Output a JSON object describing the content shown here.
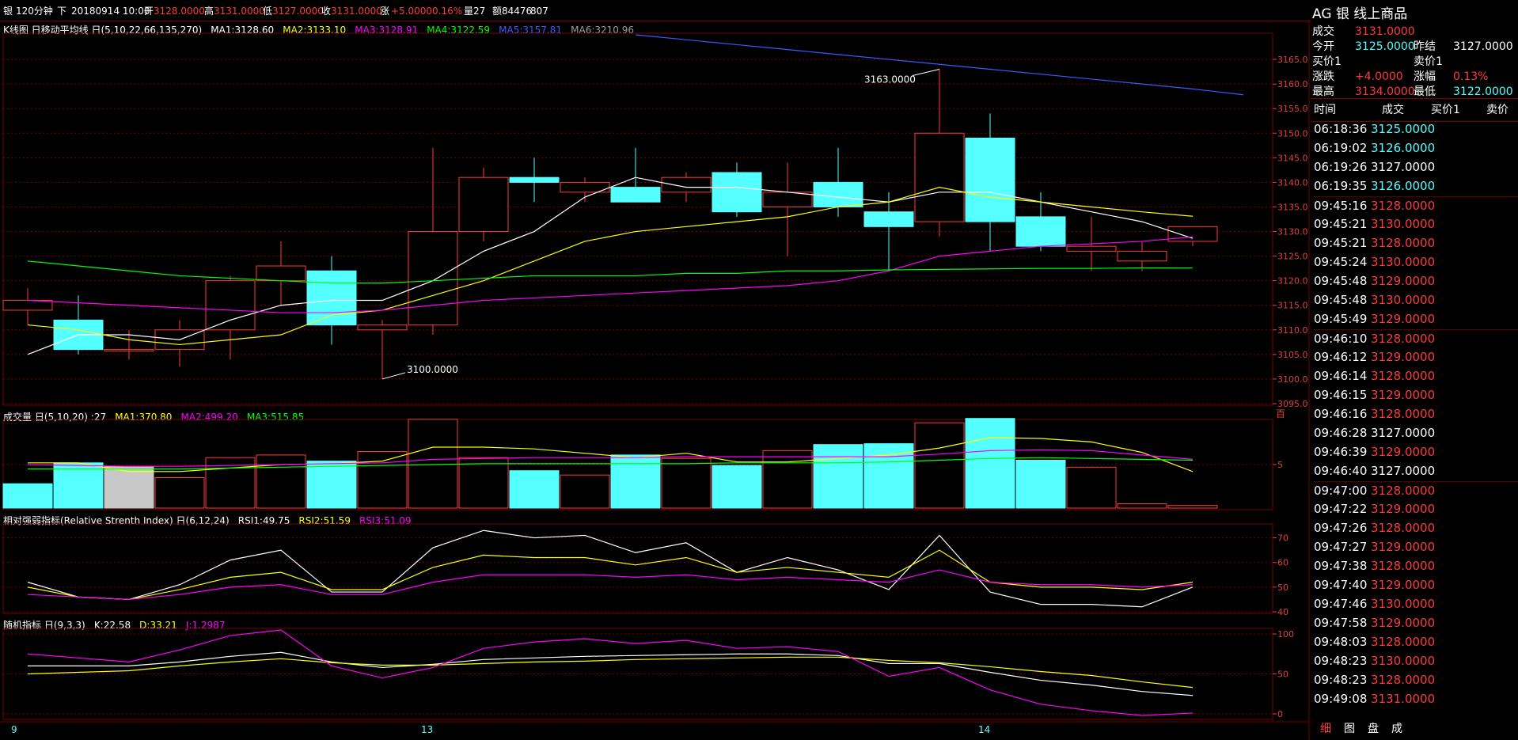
{
  "header": {
    "symbol": "银",
    "period": "120分钟",
    "direction": "下",
    "datetime": "20180914 10:00",
    "open_label": "开",
    "open": "3128.0000",
    "high_label": "高",
    "high": "3131.0000",
    "low_label": "低",
    "low": "3127.0000",
    "close_label": "收",
    "close": "3131.0000",
    "change_label": "涨",
    "change": "+5.0000",
    "change_pct": "0.16%",
    "volume_label": "量27",
    "amount_label": "额84476",
    "extra": "807"
  },
  "panels": {
    "kline": {
      "title": "K线图 日移动平均线 日(5,10,22,66,135,270)",
      "ma": [
        {
          "label": "MA1:3128.60",
          "color": "#ffffff"
        },
        {
          "label": "MA2:3133.10",
          "color": "#ffff00"
        },
        {
          "label": "MA3:3128.91",
          "color": "#ff00ff"
        },
        {
          "label": "MA4:3122.59",
          "color": "#00ff00"
        },
        {
          "label": "MA5:3157.81",
          "color": "#3a5bff"
        },
        {
          "label": "MA6:3210.96",
          "color": "#9b9b9b"
        }
      ],
      "max_annotation": "3163.0000",
      "min_annotation": "3100.0000"
    },
    "volume": {
      "title": "成交量 日(5,10,20) :27",
      "ma": [
        {
          "label": "MA1:370.80",
          "color": "#ffff00"
        },
        {
          "label": "MA2:499.20",
          "color": "#ff00ff"
        },
        {
          "label": "MA3:515.85",
          "color": "#00ff00"
        }
      ],
      "unit": "百"
    },
    "rsi": {
      "title": "相对强弱指标(Relative Strenth Index) 日(6,12,24)",
      "ma": [
        {
          "label": "RSI1:49.75",
          "color": "#ffffff"
        },
        {
          "label": "RSI2:51.59",
          "color": "#ffff00"
        },
        {
          "label": "RSI3:51.09",
          "color": "#ff00ff"
        }
      ]
    },
    "kdj": {
      "title": "随机指标 日(9,3,3)",
      "ma": [
        {
          "label": "K:22.58",
          "color": "#ffffff"
        },
        {
          "label": "D:33.21",
          "color": "#ffff00"
        },
        {
          "label": "J:1.2987",
          "color": "#ff00ff"
        }
      ]
    }
  },
  "x_axis_labels": [
    {
      "index": 0,
      "label": "9"
    },
    {
      "index": 8,
      "label": "13"
    },
    {
      "index": 19,
      "label": "14"
    }
  ],
  "colors": {
    "up": "#ff3a3a",
    "down": "#54ffff",
    "grid": "#7a0000",
    "axis_text": "#e04040"
  },
  "chart_data": [
    {
      "type": "candlestick",
      "panel": "kline",
      "ylim": [
        3095,
        3170
      ],
      "yticks": [
        "3095.0",
        "3100.0",
        "3105.0",
        "3110.0",
        "3115.0",
        "3120.0",
        "3125.0",
        "3130.0",
        "3135.0",
        "3140.0",
        "3145.0",
        "3150.0",
        "3155.0",
        "3160.0",
        "3165.0"
      ],
      "candles": [
        {
          "o": 3114,
          "h": 3118.5,
          "l": 3111,
          "c": 3116
        },
        {
          "o": 3112,
          "h": 3117,
          "l": 3105,
          "c": 3106
        },
        {
          "o": 3106,
          "h": 3110,
          "l": 3104,
          "c": 3106
        },
        {
          "o": 3106,
          "h": 3112,
          "l": 3102.5,
          "c": 3110
        },
        {
          "o": 3110,
          "h": 3121,
          "l": 3104,
          "c": 3120
        },
        {
          "o": 3120,
          "h": 3128,
          "l": 3115,
          "c": 3123
        },
        {
          "o": 3122,
          "h": 3125,
          "l": 3107,
          "c": 3111
        },
        {
          "o": 3110,
          "h": 3112,
          "l": 3100,
          "c": 3111
        },
        {
          "o": 3111,
          "h": 3147,
          "l": 3109,
          "c": 3130
        },
        {
          "o": 3130,
          "h": 3143,
          "l": 3128,
          "c": 3141
        },
        {
          "o": 3141,
          "h": 3145,
          "l": 3136,
          "c": 3140
        },
        {
          "o": 3138,
          "h": 3141,
          "l": 3136,
          "c": 3140
        },
        {
          "o": 3139,
          "h": 3147,
          "l": 3136,
          "c": 3136
        },
        {
          "o": 3138,
          "h": 3142,
          "l": 3136,
          "c": 3141
        },
        {
          "o": 3142,
          "h": 3144,
          "l": 3133,
          "c": 3134
        },
        {
          "o": 3135,
          "h": 3144,
          "l": 3125,
          "c": 3138
        },
        {
          "o": 3140,
          "h": 3147,
          "l": 3133,
          "c": 3135
        },
        {
          "o": 3134,
          "h": 3138,
          "l": 3122,
          "c": 3131
        },
        {
          "o": 3132,
          "h": 3163,
          "l": 3129,
          "c": 3150
        },
        {
          "o": 3149,
          "h": 3154,
          "l": 3126,
          "c": 3132
        },
        {
          "o": 3133,
          "h": 3138,
          "l": 3126,
          "c": 3127
        },
        {
          "o": 3126,
          "h": 3133,
          "l": 3122,
          "c": 3127
        },
        {
          "o": 3124,
          "h": 3128,
          "l": 3122,
          "c": 3126
        },
        {
          "o": 3128,
          "h": 3131,
          "l": 3127,
          "c": 3131
        }
      ],
      "ma_lines": [
        {
          "name": "MA1",
          "color": "#ffffff",
          "values": [
            3105,
            3109,
            3109,
            3108,
            3112,
            3115,
            3116,
            3116,
            3120,
            3126,
            3130,
            3137,
            3141,
            3139,
            3139,
            3138,
            3137,
            3136,
            3138,
            3138,
            3136,
            3134,
            3132,
            3128.6
          ]
        },
        {
          "name": "MA2",
          "color": "#ffff00",
          "values": [
            3111,
            3110,
            3108,
            3107,
            3108,
            3109,
            3113,
            3114,
            3117,
            3120,
            3124,
            3128,
            3130,
            3131,
            3132,
            3133,
            3135,
            3136,
            3139,
            3137,
            3136,
            3135,
            3134,
            3133.1
          ]
        },
        {
          "name": "MA3",
          "color": "#ff00ff",
          "values": [
            3116,
            3115.5,
            3115,
            3114.5,
            3114,
            3113.5,
            3113.5,
            3114,
            3115,
            3116,
            3116.5,
            3117,
            3117.5,
            3118,
            3118.5,
            3119,
            3120,
            3122,
            3125,
            3126,
            3127,
            3127.5,
            3128,
            3128.91
          ]
        },
        {
          "name": "MA4",
          "color": "#00ff00",
          "values": [
            3124,
            3123,
            3122,
            3121,
            3120.5,
            3120,
            3119.5,
            3119.5,
            3120,
            3120.5,
            3121,
            3121,
            3121,
            3121.5,
            3121.5,
            3122,
            3122,
            3122.2,
            3122.3,
            3122.4,
            3122.5,
            3122.5,
            3122.6,
            3122.59
          ]
        },
        {
          "name": "MA5",
          "color": "#3a5bff",
          "start": 12,
          "values": [
            3170,
            3169,
            3168,
            3167,
            3166,
            3165,
            3164,
            3163,
            3162,
            3161,
            3160,
            3159,
            3157.81
          ]
        }
      ]
    },
    {
      "type": "bar",
      "panel": "volume",
      "ylim": [
        0,
        10
      ],
      "ytick_label": "5",
      "values": [
        2.8,
        5.2,
        4.8,
        3.5,
        5.8,
        6.1,
        5.4,
        6.5,
        10.2,
        5.8,
        4.3,
        3.8,
        6.1,
        5.7,
        4.9,
        6.6,
        7.3,
        7.4,
        9.8,
        10.3,
        5.5,
        4.7,
        0.5,
        0.3
      ],
      "direction": [
        "down",
        "down",
        "flat",
        "up",
        "up",
        "up",
        "down",
        "up",
        "up",
        "up",
        "down",
        "up",
        "down",
        "up",
        "down",
        "up",
        "down",
        "down",
        "up",
        "down",
        "down",
        "up",
        "up",
        "up"
      ],
      "ma_lines": [
        {
          "name": "MA1",
          "color": "#ffff00",
          "values": [
            5.2,
            5.2,
            4.2,
            4.2,
            4.6,
            5.0,
            5.1,
            5.4,
            7.0,
            7.0,
            6.8,
            6.3,
            5.8,
            6.3,
            5.3,
            5.3,
            5.7,
            6.1,
            6.9,
            8.1,
            8.0,
            7.6,
            6.4,
            4.2
          ]
        },
        {
          "name": "MA2",
          "color": "#ff00ff",
          "values": [
            5.0,
            4.9,
            4.8,
            4.8,
            4.9,
            5.0,
            5.1,
            5.2,
            5.6,
            5.7,
            5.8,
            5.8,
            5.8,
            5.9,
            5.9,
            5.9,
            5.9,
            5.9,
            6.2,
            6.6,
            6.7,
            6.6,
            6.1,
            5.6
          ]
        },
        {
          "name": "MA3",
          "color": "#00ff00",
          "values": [
            4.5,
            4.5,
            4.5,
            4.5,
            4.6,
            4.7,
            4.8,
            4.9,
            5.0,
            5.1,
            5.1,
            5.1,
            5.1,
            5.1,
            5.2,
            5.2,
            5.2,
            5.3,
            5.5,
            5.7,
            5.8,
            5.7,
            5.6,
            5.5
          ]
        }
      ]
    },
    {
      "type": "line",
      "panel": "rsi",
      "ylim": [
        40,
        75
      ],
      "yticks": [
        "40",
        "50",
        "60",
        "70"
      ],
      "series": [
        {
          "name": "RSI1",
          "color": "#ffffff",
          "values": [
            52,
            46,
            45,
            51,
            61,
            65,
            48,
            48,
            66,
            73,
            70,
            71,
            64,
            68,
            56,
            62,
            57,
            49,
            71,
            48,
            43,
            43,
            42,
            50
          ]
        },
        {
          "name": "RSI2",
          "color": "#ffff00",
          "values": [
            50,
            46,
            45,
            49,
            54,
            56,
            49,
            49,
            58,
            63,
            62,
            62,
            59,
            62,
            56,
            58,
            56,
            54,
            65,
            52,
            50,
            50,
            49,
            52
          ]
        },
        {
          "name": "RSI3",
          "color": "#ff00ff",
          "values": [
            47,
            46,
            45,
            47,
            50,
            51,
            47,
            47,
            52,
            55,
            55,
            55,
            54,
            55,
            53,
            54,
            53,
            52,
            57,
            52,
            51,
            51,
            50,
            51
          ]
        }
      ]
    },
    {
      "type": "line",
      "panel": "kdj",
      "ylim": [
        -5,
        105
      ],
      "yticks": [
        "0",
        "50",
        "100"
      ],
      "series": [
        {
          "name": "K",
          "color": "#ffffff",
          "values": [
            60,
            60,
            60,
            65,
            72,
            77,
            65,
            58,
            62,
            68,
            70,
            72,
            73,
            74,
            75,
            75,
            73,
            63,
            63,
            52,
            42,
            36,
            28,
            23
          ]
        },
        {
          "name": "D",
          "color": "#ffff00",
          "values": [
            50,
            52,
            54,
            60,
            65,
            69,
            64,
            61,
            61,
            63,
            65,
            66,
            68,
            69,
            70,
            71,
            71,
            67,
            64,
            59,
            53,
            48,
            40,
            33
          ]
        },
        {
          "name": "J",
          "color": "#ff00ff",
          "values": [
            75,
            70,
            65,
            80,
            98,
            105,
            60,
            45,
            58,
            82,
            90,
            94,
            88,
            92,
            82,
            84,
            78,
            47,
            58,
            30,
            12,
            4,
            -2,
            1
          ]
        }
      ]
    }
  ],
  "sidebar": {
    "title": "AG 银  线上商品",
    "quote": [
      {
        "label": "成交",
        "value": "3131.0000",
        "color": "#ff3a3a"
      },
      {
        "label": "今开",
        "value": "3125.0000",
        "color": "#54ffff",
        "label2": "昨结",
        "value2": "3127.0000",
        "color2": "#ffffff"
      },
      {
        "label": "买价1",
        "value": "",
        "label2": "卖价1",
        "value2": ""
      },
      {
        "label": "涨跌",
        "value": "+4.0000",
        "color": "#ff3a3a",
        "label2": "涨幅",
        "value2": "0.13%",
        "color2": "#ff3a3a"
      },
      {
        "label": "最高",
        "value": "3134.0000",
        "color": "#ff3a3a",
        "label2": "最低",
        "value2": "3122.0000",
        "color2": "#54ffff"
      }
    ],
    "table_headers": [
      "时间",
      "成交",
      "买价1",
      "卖价"
    ],
    "trades": [
      {
        "time": "06:18:36",
        "price": "3125.0000",
        "color": "#54ffff"
      },
      {
        "time": "06:19:02",
        "price": "3126.0000",
        "color": "#54ffff"
      },
      {
        "time": "06:19:26",
        "price": "3127.0000",
        "color": "#ffffff"
      },
      {
        "time": "06:19:35",
        "price": "3126.0000",
        "color": "#54ffff"
      },
      {
        "time": "09:45:16",
        "price": "3128.0000",
        "color": "#ff3a3a"
      },
      {
        "time": "09:45:21",
        "price": "3130.0000",
        "color": "#ff3a3a"
      },
      {
        "time": "09:45:21",
        "price": "3128.0000",
        "color": "#ff3a3a"
      },
      {
        "time": "09:45:24",
        "price": "3130.0000",
        "color": "#ff3a3a"
      },
      {
        "time": "09:45:48",
        "price": "3129.0000",
        "color": "#ff3a3a"
      },
      {
        "time": "09:45:48",
        "price": "3130.0000",
        "color": "#ff3a3a"
      },
      {
        "time": "09:45:49",
        "price": "3129.0000",
        "color": "#ff3a3a"
      },
      {
        "time": "09:46:10",
        "price": "3128.0000",
        "color": "#ff3a3a"
      },
      {
        "time": "09:46:12",
        "price": "3129.0000",
        "color": "#ff3a3a"
      },
      {
        "time": "09:46:14",
        "price": "3128.0000",
        "color": "#ff3a3a"
      },
      {
        "time": "09:46:15",
        "price": "3129.0000",
        "color": "#ff3a3a"
      },
      {
        "time": "09:46:16",
        "price": "3128.0000",
        "color": "#ff3a3a"
      },
      {
        "time": "09:46:28",
        "price": "3127.0000",
        "color": "#ffffff"
      },
      {
        "time": "09:46:39",
        "price": "3129.0000",
        "color": "#ff3a3a"
      },
      {
        "time": "09:46:40",
        "price": "3127.0000",
        "color": "#ffffff"
      },
      {
        "time": "09:47:00",
        "price": "3128.0000",
        "color": "#ff3a3a"
      },
      {
        "time": "09:47:22",
        "price": "3129.0000",
        "color": "#ff3a3a"
      },
      {
        "time": "09:47:26",
        "price": "3128.0000",
        "color": "#ff3a3a"
      },
      {
        "time": "09:47:27",
        "price": "3129.0000",
        "color": "#ff3a3a"
      },
      {
        "time": "09:47:38",
        "price": "3128.0000",
        "color": "#ff3a3a"
      },
      {
        "time": "09:47:40",
        "price": "3129.0000",
        "color": "#ff3a3a"
      },
      {
        "time": "09:47:46",
        "price": "3130.0000",
        "color": "#ff3a3a"
      },
      {
        "time": "09:47:58",
        "price": "3129.0000",
        "color": "#ff3a3a"
      },
      {
        "time": "09:48:03",
        "price": "3128.0000",
        "color": "#ff3a3a"
      },
      {
        "time": "09:48:23",
        "price": "3130.0000",
        "color": "#ff3a3a"
      },
      {
        "time": "09:48:23",
        "price": "3128.0000",
        "color": "#ff3a3a"
      },
      {
        "time": "09:49:08",
        "price": "3131.0000",
        "color": "#ff3a3a"
      }
    ],
    "tabs": [
      "细",
      "图",
      "盘",
      "成"
    ]
  }
}
